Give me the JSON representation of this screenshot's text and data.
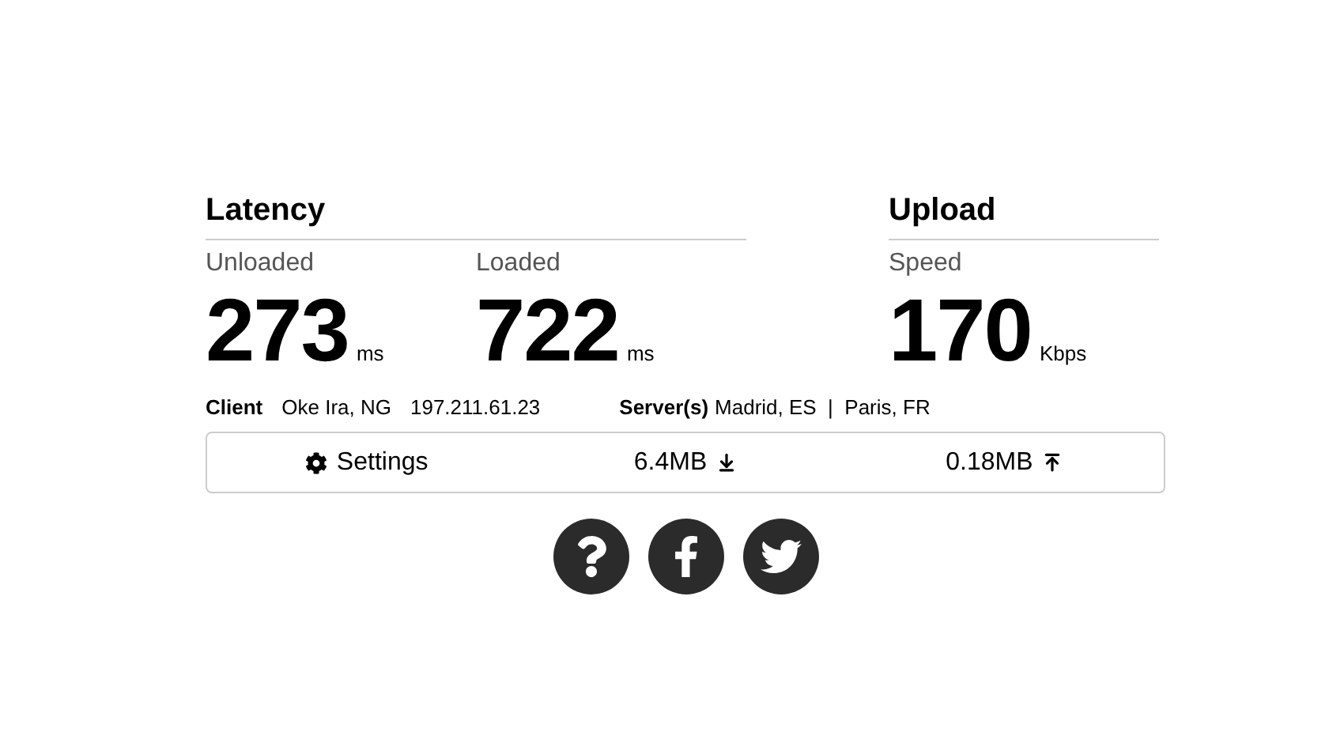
{
  "sections": [
    {
      "title": "Latency",
      "metrics": [
        {
          "label": "Unloaded",
          "value": "273",
          "unit": "ms"
        },
        {
          "label": "Loaded",
          "value": "722",
          "unit": "ms"
        }
      ]
    },
    {
      "title": "Upload",
      "metrics": [
        {
          "label": "Speed",
          "value": "170",
          "unit": "Kbps"
        }
      ]
    }
  ],
  "info": {
    "client_label": "Client",
    "client_location": "Oke Ira, NG",
    "client_ip": "197.211.61.23",
    "server_label": "Server(s)",
    "servers": "Madrid, ES  |  Paris, FR"
  },
  "bar": {
    "settings": "Settings",
    "download": "6.4MB",
    "upload": "0.18MB"
  },
  "social": [
    {
      "kind": "help"
    },
    {
      "kind": "facebook"
    },
    {
      "kind": "twitter"
    }
  ]
}
